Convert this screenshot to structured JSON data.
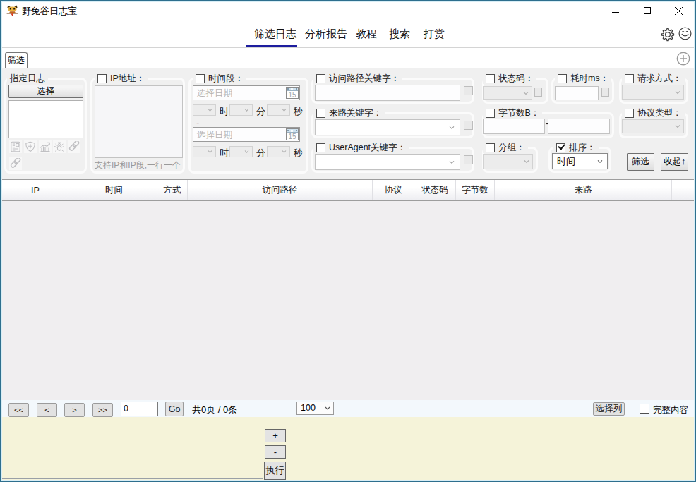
{
  "window": {
    "title": "野兔谷日志宝",
    "controls": {
      "minimize": "minimize",
      "maximize": "maximize",
      "close": "close"
    }
  },
  "colors": {
    "active_tab_underline": "#1d1d9e",
    "panel_bg": "#f0f0f0",
    "footer_bg": "#f5f3d9",
    "window_border": "#2f7191"
  },
  "menu": {
    "tabs": [
      {
        "label": "筛选日志",
        "active": true
      },
      {
        "label": "分析报告",
        "active": false
      },
      {
        "label": "教程",
        "active": false
      },
      {
        "label": "搜索",
        "active": false
      },
      {
        "label": "打赏",
        "active": false
      }
    ]
  },
  "tabstrip": {
    "tab": "筛选"
  },
  "filter": {
    "specify_log": {
      "label": "指定日志",
      "select_button": "选择",
      "icons": [
        "log-file-icon",
        "shield-plus-icon",
        "chart-icon",
        "spider-icon",
        "link-icon",
        "link-icon"
      ]
    },
    "ip": {
      "label": "IP地址：",
      "hint": "支持IP和IP段,一行一个"
    },
    "time_range": {
      "label": "时间段：",
      "date_placeholder": "选择日期",
      "calendar_day": "15",
      "hour": "时",
      "minute": "分",
      "second": "秒",
      "separator": "-"
    },
    "path_keyword": {
      "label": "访问路径关键字："
    },
    "referer_keyword": {
      "label": "来路关键字："
    },
    "useragent_keyword": {
      "label": "UserAgent关键字："
    },
    "status_code": {
      "label": "状态码："
    },
    "elapsed_ms": {
      "label": "耗时ms："
    },
    "request_method": {
      "label": "请求方式："
    },
    "bytes": {
      "label": "字节数B：",
      "separator": "-"
    },
    "protocol": {
      "label": "协议类型："
    },
    "group_by": {
      "label": "分组："
    },
    "sort": {
      "label": "排序：",
      "value": "时间",
      "checked": true
    },
    "filter_button": "筛选",
    "collapse_button": "收起↑"
  },
  "table": {
    "columns": [
      {
        "label": "IP"
      },
      {
        "label": "时间"
      },
      {
        "label": "方式"
      },
      {
        "label": "访问路径"
      },
      {
        "label": "协议"
      },
      {
        "label": "状态码"
      },
      {
        "label": "字节数"
      },
      {
        "label": "来路"
      }
    ],
    "rows": []
  },
  "pagination": {
    "first": "<<",
    "prev": "<",
    "next": ">",
    "last": ">>",
    "page_value": "0",
    "go": "Go",
    "summary": "共0页 / 0条",
    "page_size": "100",
    "choose_columns": "选择列",
    "full_content": "完整内容"
  },
  "footer": {
    "plus": "+",
    "minus": "-",
    "execute": "执行"
  }
}
